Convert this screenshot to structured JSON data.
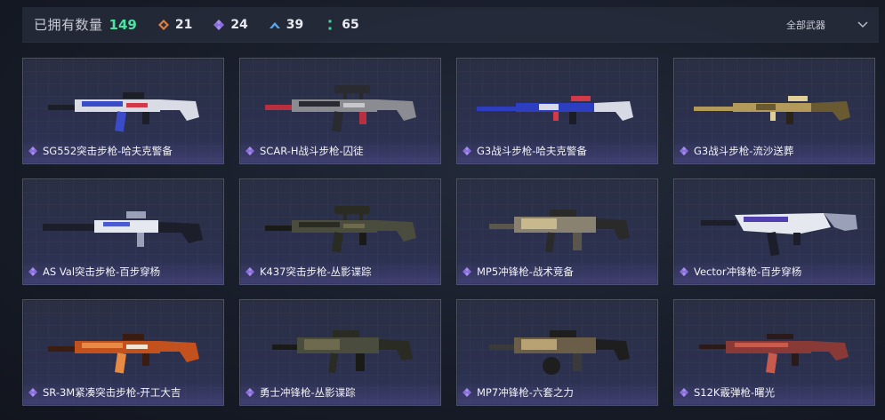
{
  "header": {
    "owned_label": "已拥有数量",
    "owned_count": "149",
    "stats": [
      {
        "icon": "orange-diamond-icon",
        "color": "#e0803f",
        "value": "21"
      },
      {
        "icon": "purple-diamond-icon",
        "color": "#a78cf0",
        "value": "24"
      },
      {
        "icon": "blue-chevron-icon",
        "color": "#58a8f0",
        "value": "39"
      },
      {
        "icon": "green-dots-icon",
        "color": "#45d6a0",
        "value": "65"
      }
    ],
    "filter_label": "全部武器"
  },
  "colors": {
    "accent_green": "#4be3a1",
    "card_border": "#4b5276",
    "gem_purple": "#a78cf0"
  },
  "weapons": [
    {
      "name": "SG552突击步枪-哈夫克警备",
      "palette": [
        "#d9dbe5",
        "#3a4cc8",
        "#d23a4a",
        "#1c1e28"
      ],
      "gun_type": "rifle"
    },
    {
      "name": "SCAR-H战斗步枪-囚徒",
      "palette": [
        "#8a8c92",
        "#2a2b30",
        "#c8c8cc",
        "#b83040"
      ],
      "gun_type": "rifle-scoped"
    },
    {
      "name": "G3战斗步枪-哈夫克警备",
      "palette": [
        "#2d3fc0",
        "#d7dae4",
        "#d23a4a",
        "#1a1c26"
      ],
      "gun_type": "long"
    },
    {
      "name": "G3战斗步枪-流沙送葬",
      "palette": [
        "#b39a5a",
        "#6a5a32",
        "#e0cf96",
        "#2a2418"
      ],
      "gun_type": "long"
    },
    {
      "name": "AS Val突击步枪-百步穿杨",
      "palette": [
        "#e6e8f0",
        "#1c1e2a",
        "#4a5ad0",
        "#9aa0b8"
      ],
      "gun_type": "suppressed"
    },
    {
      "name": "K437突击步枪-丛影谍踪",
      "palette": [
        "#4a4c3e",
        "#2a2c24",
        "#6e6a4e",
        "#1a1b16"
      ],
      "gun_type": "rifle-scoped"
    },
    {
      "name": "MP5冲锋枪-战术竞备",
      "palette": [
        "#8a8270",
        "#2a2a2a",
        "#c8b88e",
        "#5a564c"
      ],
      "gun_type": "smg"
    },
    {
      "name": "Vector冲锋枪-百步穿杨",
      "palette": [
        "#e6e8f0",
        "#1c1e2a",
        "#5040b0",
        "#9aa0b8"
      ],
      "gun_type": "vector"
    },
    {
      "name": "SR-3M紧凑突击步枪-开工大吉",
      "palette": [
        "#c2511e",
        "#e88a44",
        "#f2e6d6",
        "#3a1c10"
      ],
      "gun_type": "rifle"
    },
    {
      "name": "勇士冲锋枪-丛影谍踪",
      "palette": [
        "#4a4c3e",
        "#2a2c24",
        "#6e6a4e",
        "#1a1b16"
      ],
      "gun_type": "smg"
    },
    {
      "name": "MP7冲锋枪-六套之力",
      "palette": [
        "#6a5e48",
        "#1e1e1e",
        "#b8a274",
        "#3a3a3a"
      ],
      "gun_type": "smg-drum"
    },
    {
      "name": "S12K霰弹枪-曙光",
      "palette": [
        "#8a3a36",
        "#c85a4e",
        "#e8d8c8",
        "#2a1a1a"
      ],
      "gun_type": "shotgun"
    }
  ]
}
